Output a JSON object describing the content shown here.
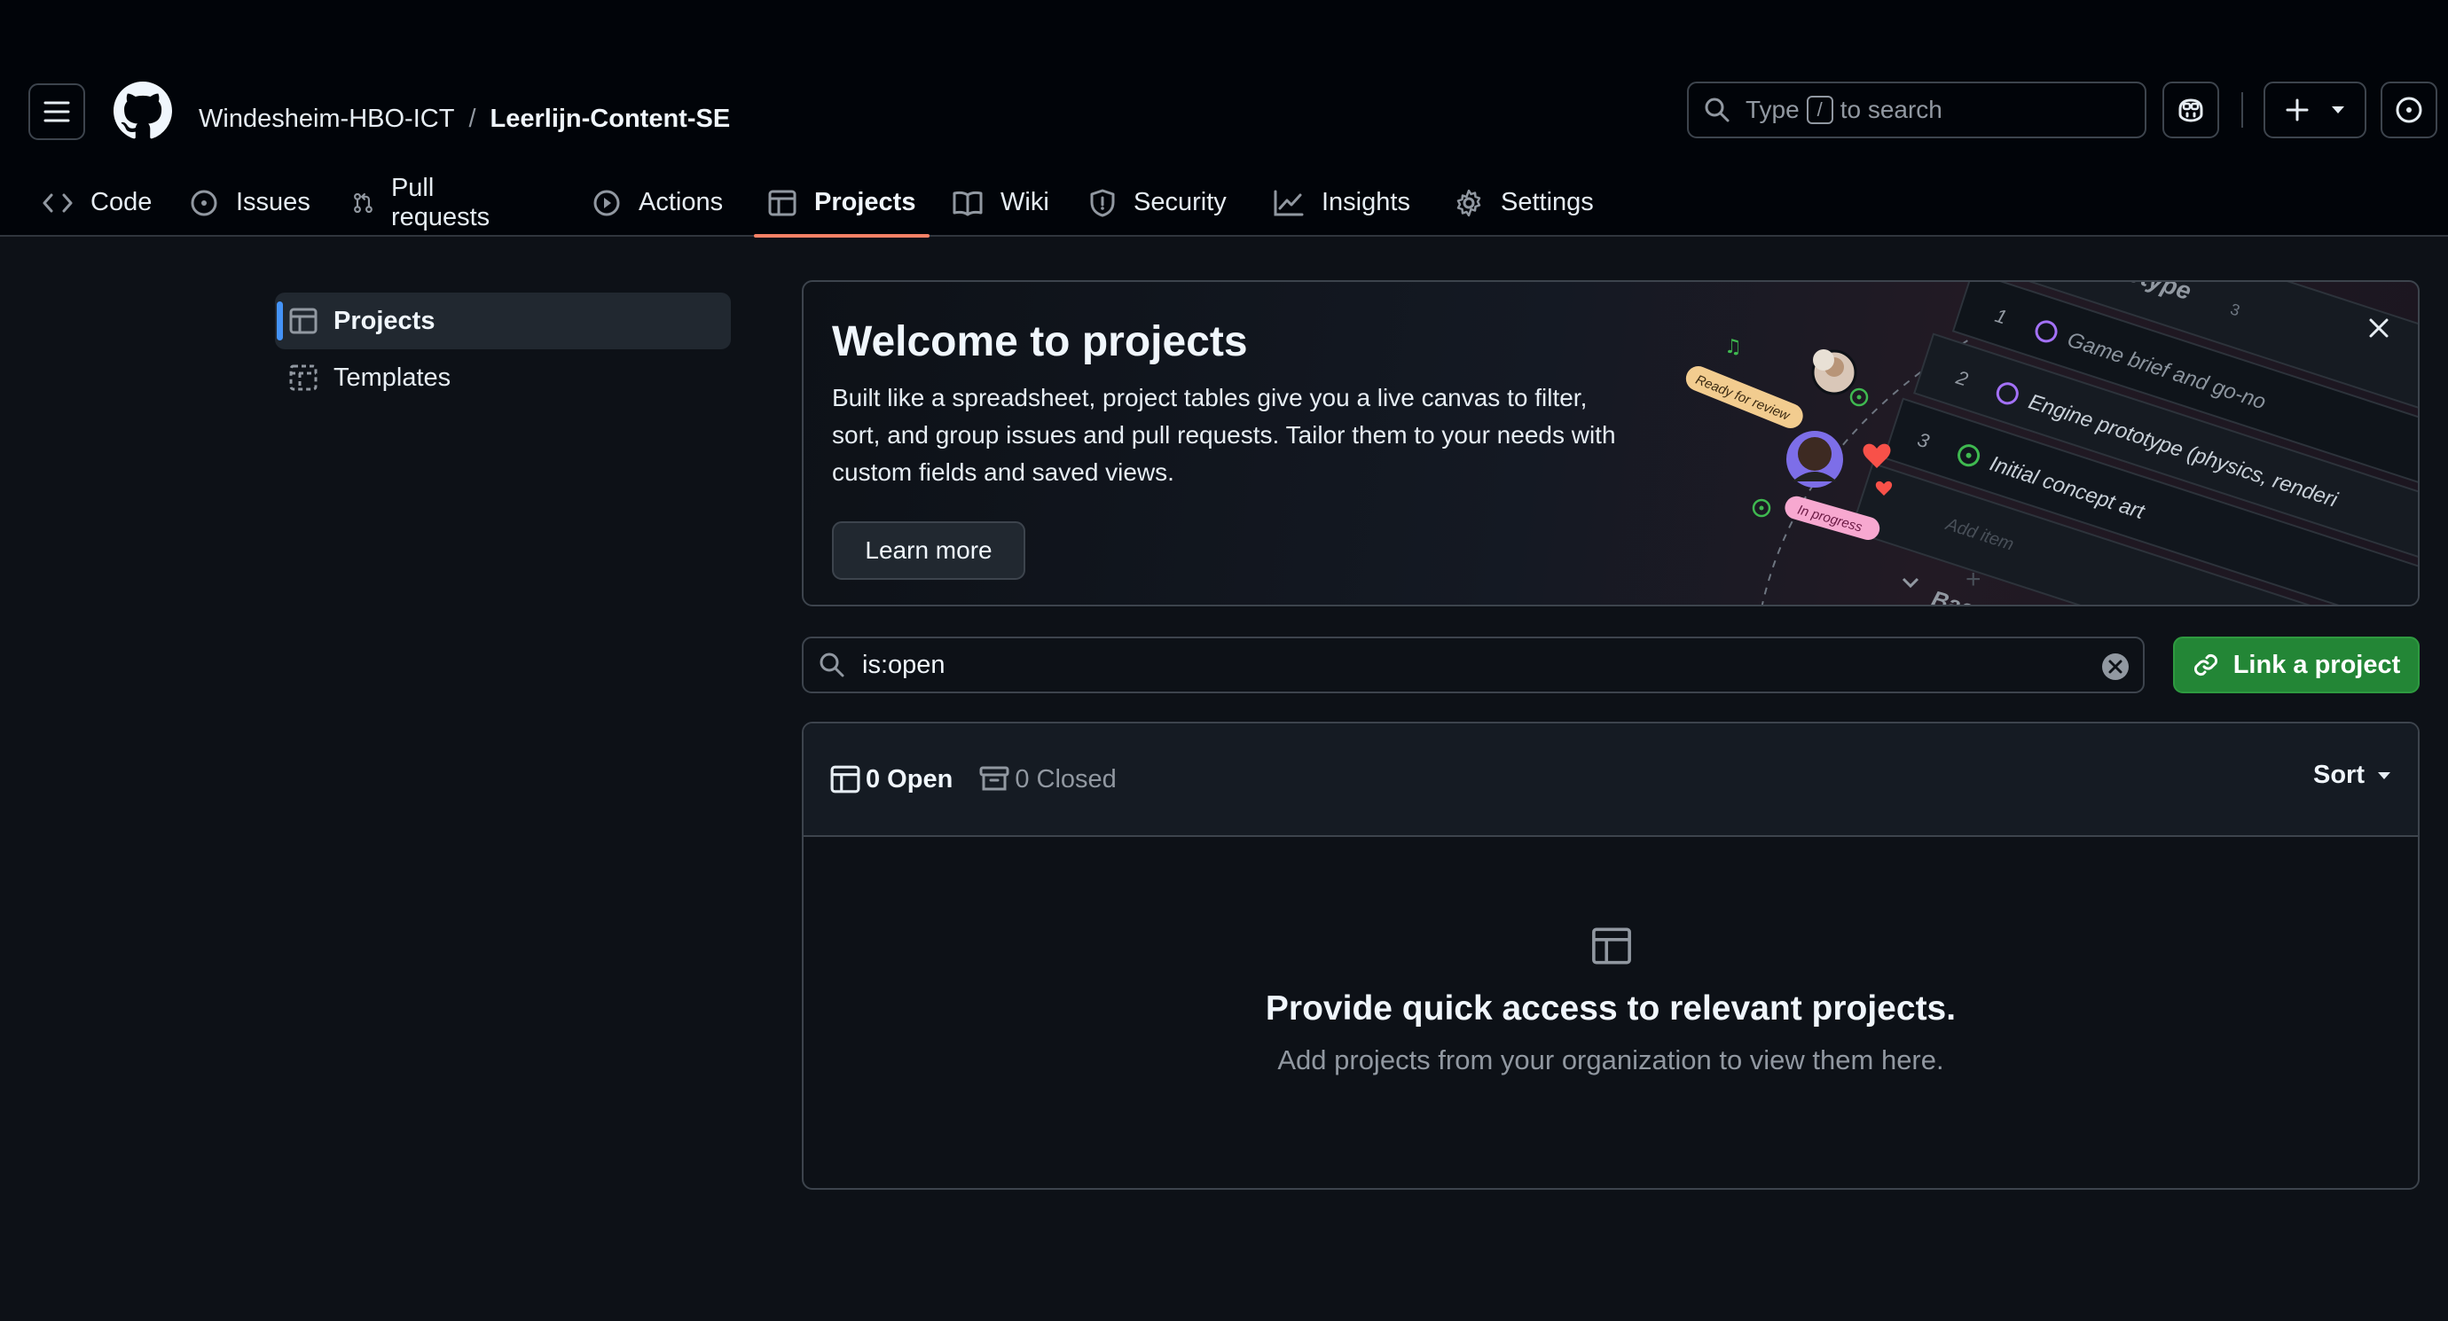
{
  "header": {
    "org": "Windesheim-HBO-ICT",
    "separator": "/",
    "repo": "Leerlijn-Content-SE",
    "search_prefix": "Type",
    "search_key": "/",
    "search_suffix": "to search"
  },
  "tabs": [
    {
      "label": "Code",
      "icon": "code-icon"
    },
    {
      "label": "Issues",
      "icon": "issue-opened-icon"
    },
    {
      "label": "Pull requests",
      "icon": "git-pull-request-icon"
    },
    {
      "label": "Actions",
      "icon": "play-icon"
    },
    {
      "label": "Projects",
      "icon": "table-icon",
      "selected": true
    },
    {
      "label": "Wiki",
      "icon": "book-icon"
    },
    {
      "label": "Security",
      "icon": "shield-icon"
    },
    {
      "label": "Insights",
      "icon": "graph-icon"
    },
    {
      "label": "Settings",
      "icon": "gear-icon"
    }
  ],
  "sidebar": {
    "items": [
      {
        "label": "Projects",
        "icon": "table-icon",
        "active": true
      },
      {
        "label": "Templates",
        "icon": "template-icon"
      }
    ]
  },
  "welcome": {
    "title": "Welcome to projects",
    "body": "Built like a spreadsheet, project tables give you a live canvas to filter, sort, and group issues and pull requests. Tailor them to your needs with custom fields and saved views.",
    "learn_more": "Learn more",
    "illustration": {
      "group_label": "Prototype",
      "group_count": "3",
      "rows": [
        {
          "num": "1",
          "text": "Game brief and go-no"
        },
        {
          "num": "2",
          "text": "Engine prototype (physics, renderi"
        },
        {
          "num": "3",
          "text": "Initial concept art"
        }
      ],
      "add_item": "Add item",
      "next_group": "Bac",
      "badge_review": "Ready for review",
      "badge_progress": "In progress"
    }
  },
  "filter": {
    "value": "is:open"
  },
  "link_button": "Link a project",
  "list": {
    "open_label": "0 Open",
    "closed_label": "0 Closed",
    "sort_label": "Sort",
    "empty_title": "Provide quick access to relevant projects.",
    "empty_body": "Add projects from your organization to view them here."
  },
  "colors": {
    "background": "#0d1117",
    "header_bg": "#010409",
    "accent_underline": "#f78166",
    "active_marker": "#4493f8",
    "primary_button": "#238636",
    "muted_text": "#9198a1"
  }
}
